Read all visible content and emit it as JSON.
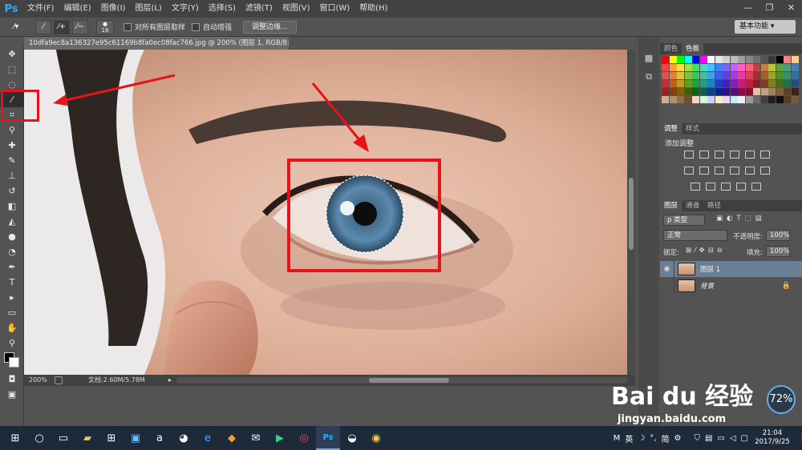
{
  "app": {
    "logo": "Ps"
  },
  "menu": [
    "文件(F)",
    "编辑(E)",
    "图像(I)",
    "图层(L)",
    "文字(Y)",
    "选择(S)",
    "滤镜(T)",
    "视图(V)",
    "窗口(W)",
    "帮助(H)"
  ],
  "window_controls": [
    "—",
    "❐",
    "✕"
  ],
  "options_bar": {
    "brush_size": "18",
    "sample_all_layers": "对所有图层取样",
    "auto_enhance": "自动增强",
    "refine_edge": "调整边缘...",
    "workspace": "基本功能"
  },
  "document": {
    "tab_title": "10dfa9ec8a136327e95c61169b8fa0ec08fac766.jpg @ 200% (图层 1, RGB/8#) *",
    "zoom": "200%",
    "doc_size": "文档:2.60M/5.78M"
  },
  "panels": {
    "color_tabs": [
      "颜色",
      "色板"
    ],
    "adjust_tabs": [
      "调整",
      "样式"
    ],
    "add_adjustment": "添加调整",
    "layers_tabs": [
      "图层",
      "通道",
      "路径"
    ],
    "layer_filter": "ρ 类型",
    "blend_mode": "正常",
    "opacity_label": "不透明度:",
    "opacity_value": "100%",
    "lock_label": "锁定:",
    "fill_label": "填充:",
    "fill_value": "100%",
    "layers": [
      {
        "name": "图层 1",
        "selected": true,
        "visible": true
      },
      {
        "name": "背景",
        "selected": false,
        "visible": false,
        "locked": true
      }
    ]
  },
  "taskbar": {
    "ime": "M",
    "tray_text": [
      "英",
      "☽",
      "°,",
      "简",
      "⚙"
    ],
    "time": "21:04",
    "date": "2017/9/25"
  },
  "watermark": {
    "main": "Bai du 经验",
    "sub": "jingyan.baidu.com"
  },
  "badge": "72%",
  "colors": {
    "accent_red": "#e5141a",
    "ps_blue": "#31a8ff",
    "selected_layer": "#6a7f97"
  }
}
